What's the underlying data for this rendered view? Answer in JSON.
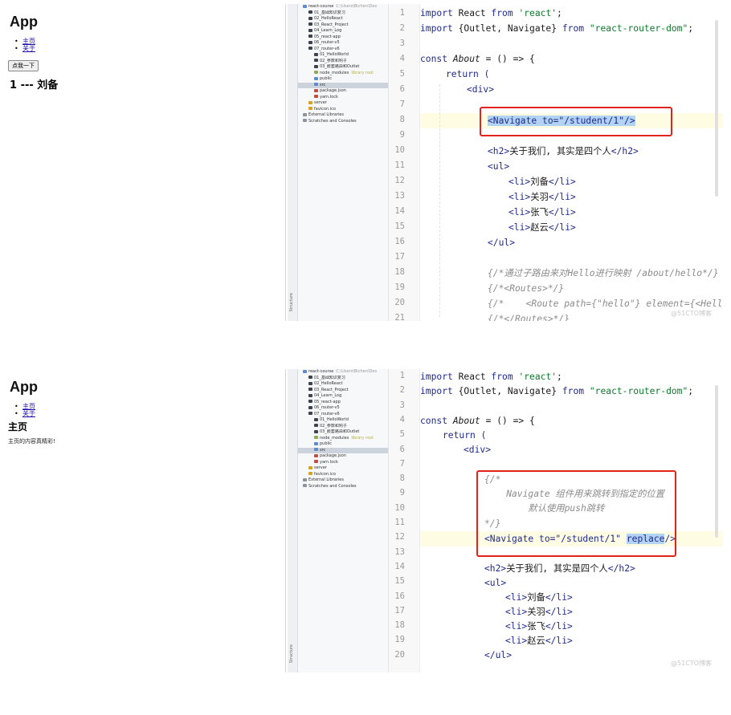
{
  "top": {
    "browser": {
      "app_title": "App",
      "nav": [
        "主页",
        "关于"
      ],
      "button_label": "点我一下",
      "result_text": "1 --- 刘备"
    },
    "sidestrip_label": "Structure",
    "tree": [
      {
        "label": "react-course",
        "extra": "C:\\Users\\Bichen\\Des",
        "icon": "blue",
        "indent": 0
      },
      {
        "label": "01_基础知识复习",
        "icon": "",
        "indent": 1
      },
      {
        "label": "02_HelloReact",
        "icon": "",
        "indent": 1
      },
      {
        "label": "03_React_Project",
        "icon": "",
        "indent": 1
      },
      {
        "label": "04_Learn_Log",
        "icon": "",
        "indent": 1
      },
      {
        "label": "05_react-app",
        "icon": "",
        "indent": 1
      },
      {
        "label": "06_router-v5",
        "icon": "",
        "indent": 1
      },
      {
        "label": "07_router-v6",
        "icon": "",
        "indent": 1
      },
      {
        "label": "01_HelloWorld",
        "icon": "",
        "indent": 2
      },
      {
        "label": "02_参数和钩子",
        "icon": "",
        "indent": 2
      },
      {
        "label": "03_嵌套路由和Outlet",
        "icon": "",
        "indent": 2
      },
      {
        "label": "node_modules",
        "extra": "library root",
        "icon": "green",
        "indent": 2
      },
      {
        "label": "public",
        "icon": "blue",
        "indent": 2
      },
      {
        "label": "src",
        "icon": "blue",
        "indent": 2,
        "selected": true
      },
      {
        "label": "package.json",
        "icon": "red",
        "indent": 2
      },
      {
        "label": "yarn.lock",
        "icon": "red",
        "indent": 2
      },
      {
        "label": "server",
        "icon": "yellow",
        "indent": 1
      },
      {
        "label": "favicon.ico",
        "icon": "yellow",
        "indent": 1
      },
      {
        "label": "External Libraries",
        "icon": "gray",
        "indent": 0
      },
      {
        "label": "Scratches and Consoles",
        "icon": "gray",
        "indent": 0
      }
    ],
    "line_numbers": [
      "1",
      "2",
      "3",
      "4",
      "5",
      "6",
      "7",
      "8",
      "9",
      "10",
      "11",
      "12",
      "13",
      "14",
      "15",
      "16",
      "17",
      "18",
      "19",
      "20",
      "21"
    ],
    "code": {
      "l1_kw": "import",
      "l1_id": " React ",
      "l1_from": "from ",
      "l1_str": "'react'",
      "l1_end": ";",
      "l2_kw": "import",
      "l2_id": " {Outlet, Navigate} ",
      "l2_from": "from ",
      "l2_str": "\"react-router-dom\"",
      "l2_end": ";",
      "l4_kw": "const ",
      "l4_fn": "About",
      "l4_rest": " = () => {",
      "l5": "return (",
      "l6_tag": "<div>",
      "l8_sel": "<Navigate to=\"/student/1\"/>",
      "l10_tag1": "<h2>",
      "l10_text": "关于我们, 其实是四个人",
      "l10_tag2": "</h2>",
      "l11_tag": "<ul>",
      "li": [
        "刘备",
        "关羽",
        "张飞",
        "赵云"
      ],
      "li_open": "<li>",
      "li_close": "</li>",
      "l16_tag": "</ul>",
      "l18": "{/*通过子路由来对Hello进行映射 /about/hello*/}",
      "l19": "{/*<Routes>*/}",
      "l20": "{/*    <Route path={\"hello\"} element={<Hello",
      "l21": "{/*</Routes>*/}"
    },
    "watermark": "@51CTO博客"
  },
  "bottom": {
    "browser": {
      "app_title": "App",
      "nav": [
        "主页",
        "关于"
      ],
      "page_heading": "主页",
      "page_text": "主页的内容真精彩!"
    },
    "sidestrip_label": "Structure",
    "line_numbers": [
      "1",
      "2",
      "3",
      "4",
      "5",
      "6",
      "7",
      "8",
      "9",
      "10",
      "11",
      "12",
      "13",
      "14",
      "15",
      "16",
      "17",
      "18",
      "19",
      "20"
    ],
    "code": {
      "l1_kw": "import",
      "l1_id": " React ",
      "l1_from": "from ",
      "l1_str": "'react'",
      "l1_end": ";",
      "l2_kw": "import",
      "l2_id": " {Outlet, Navigate} ",
      "l2_from": "from ",
      "l2_str": "\"react-router-dom\"",
      "l2_end": ";",
      "l4_kw": "const ",
      "l4_fn": "About",
      "l4_rest": " = () => {",
      "l5": "return (",
      "l6_tag": "<div>",
      "l8": "{/*",
      "l9": "    Navigate 组件用来跳转到指定的位置",
      "l10": "        默认使用push跳转",
      "l11": "*/}",
      "l12_a": "<Navigate to=\"/student/1\" ",
      "l12_sel": "replace",
      "l12_b": "/>",
      "l14_tag1": "<h2>",
      "l14_text": "关于我们, 其实是四个人",
      "l14_tag2": "</h2>",
      "l15_tag": "<ul>",
      "li": [
        "刘备",
        "关羽",
        "张飞",
        "赵云"
      ],
      "li_open": "<li>",
      "li_close": "</li>",
      "l20_tag": "</ul>"
    },
    "watermark": "@51CTO博客"
  },
  "colors": {
    "highlight_box": "#e0241b",
    "selection": "#b3d3f4",
    "keyword": "#1f2a8a",
    "string": "#0d7a2b"
  }
}
